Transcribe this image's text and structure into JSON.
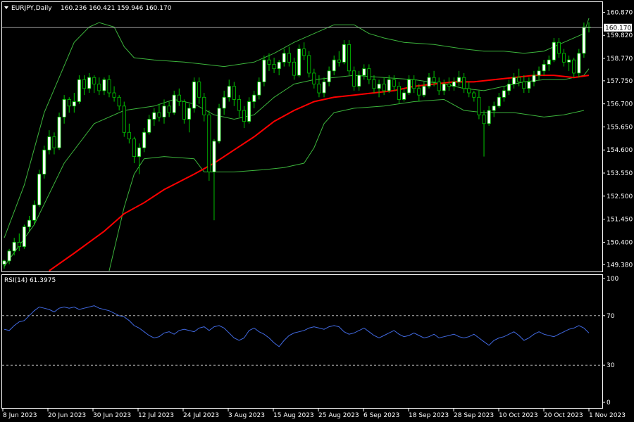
{
  "header": {
    "symbol": "EURJPY,Daily",
    "ohlc": "160.236 160.421 159.946 160.170"
  },
  "rsi_header": "RSI(14) 61.3975",
  "colors": {
    "background": "#000000",
    "grid_border": "#ffffff",
    "bull_candle": "#ffffff",
    "bear_candle": "#000000",
    "wick": "#00c800",
    "bollinger": "#3cb43c",
    "ma": "#ff0000",
    "rsi_line": "#4169e1",
    "level_line": "#b4b4b4"
  },
  "chart_data": [
    {
      "type": "candlestick",
      "ylim": [
        149.1,
        161.3
      ],
      "price_ticks": [
        "160.870",
        "159.820",
        "158.770",
        "157.750",
        "156.700",
        "155.650",
        "154.600",
        "153.550",
        "152.500",
        "151.450",
        "150.400",
        "149.380"
      ],
      "current_price": "160.170",
      "x_labels": [
        "8 Jun 2023",
        "20 Jun 2023",
        "30 Jun 2023",
        "12 Jul 2023",
        "24 Jul 2023",
        "3 Aug 2023",
        "15 Aug 2023",
        "25 Aug 2023",
        "6 Sep 2023",
        "18 Sep 2023",
        "28 Sep 2023",
        "10 Oct 2023",
        "20 Oct 2023",
        "1 Nov 2023"
      ],
      "candles": [
        [
          149.4,
          149.6,
          149.2,
          149.55
        ],
        [
          149.55,
          150.1,
          149.4,
          150.0
        ],
        [
          150.0,
          150.6,
          149.8,
          150.4
        ],
        [
          150.4,
          150.8,
          150.0,
          150.2
        ],
        [
          150.2,
          151.2,
          150.1,
          151.1
        ],
        [
          151.1,
          151.6,
          150.9,
          151.4
        ],
        [
          151.4,
          152.3,
          151.2,
          152.1
        ],
        [
          152.1,
          153.7,
          152.0,
          153.5
        ],
        [
          153.5,
          154.8,
          153.3,
          154.6
        ],
        [
          154.6,
          155.5,
          154.4,
          155.2
        ],
        [
          155.2,
          155.4,
          154.4,
          154.7
        ],
        [
          154.7,
          156.3,
          154.6,
          156.1
        ],
        [
          156.1,
          157.1,
          155.8,
          156.9
        ],
        [
          156.9,
          157.0,
          156.3,
          156.6
        ],
        [
          156.6,
          157.2,
          156.3,
          156.8
        ],
        [
          156.8,
          158.0,
          156.7,
          157.8
        ],
        [
          157.8,
          158.0,
          157.1,
          157.4
        ],
        [
          157.4,
          158.1,
          157.2,
          157.9
        ],
        [
          157.9,
          158.0,
          157.2,
          157.6
        ],
        [
          157.6,
          157.9,
          157.1,
          157.3
        ],
        [
          157.3,
          157.9,
          157.1,
          157.8
        ],
        [
          157.8,
          158.0,
          157.0,
          157.2
        ],
        [
          157.2,
          157.5,
          156.8,
          157.0
        ],
        [
          157.0,
          157.1,
          156.4,
          156.6
        ],
        [
          156.6,
          156.8,
          155.2,
          155.4
        ],
        [
          155.4,
          155.8,
          154.9,
          155.1
        ],
        [
          155.1,
          155.2,
          154.0,
          154.3
        ],
        [
          154.3,
          154.9,
          153.5,
          154.7
        ],
        [
          154.7,
          155.6,
          154.5,
          155.4
        ],
        [
          155.4,
          156.2,
          155.3,
          156.0
        ],
        [
          156.0,
          156.5,
          155.7,
          156.3
        ],
        [
          156.3,
          156.7,
          155.9,
          156.1
        ],
        [
          156.1,
          156.9,
          155.8,
          156.6
        ],
        [
          156.6,
          156.8,
          156.1,
          156.3
        ],
        [
          156.3,
          157.3,
          156.2,
          157.1
        ],
        [
          157.1,
          157.4,
          156.6,
          156.8
        ],
        [
          156.8,
          156.9,
          155.8,
          156.0
        ],
        [
          156.0,
          156.7,
          155.4,
          156.5
        ],
        [
          156.5,
          157.9,
          156.3,
          157.7
        ],
        [
          157.7,
          157.9,
          156.7,
          157.0
        ],
        [
          157.0,
          157.2,
          155.9,
          156.2
        ],
        [
          156.2,
          156.4,
          153.2,
          153.6
        ],
        [
          153.6,
          155.1,
          151.4,
          155.0
        ],
        [
          155.0,
          156.7,
          154.9,
          156.5
        ],
        [
          156.5,
          157.3,
          156.2,
          157.0
        ],
        [
          157.0,
          157.8,
          156.8,
          157.5
        ],
        [
          157.5,
          157.7,
          156.6,
          156.9
        ],
        [
          156.9,
          157.1,
          156.1,
          156.4
        ],
        [
          156.4,
          156.6,
          155.6,
          155.9
        ],
        [
          155.9,
          157.0,
          155.8,
          156.8
        ],
        [
          156.8,
          157.3,
          156.5,
          157.1
        ],
        [
          157.1,
          157.9,
          156.9,
          157.7
        ],
        [
          157.7,
          158.9,
          157.5,
          158.7
        ],
        [
          158.7,
          159.0,
          158.2,
          158.5
        ],
        [
          158.5,
          158.8,
          158.1,
          158.3
        ],
        [
          158.3,
          158.7,
          158.0,
          158.6
        ],
        [
          158.6,
          159.2,
          158.4,
          159.0
        ],
        [
          159.0,
          159.3,
          158.4,
          158.6
        ],
        [
          158.6,
          158.8,
          157.8,
          158.0
        ],
        [
          158.0,
          159.4,
          157.9,
          159.2
        ],
        [
          159.2,
          159.5,
          158.7,
          158.9
        ],
        [
          158.9,
          159.1,
          157.9,
          158.1
        ],
        [
          158.1,
          158.3,
          157.4,
          157.6
        ],
        [
          157.6,
          158.0,
          157.0,
          157.2
        ],
        [
          157.2,
          157.9,
          157.0,
          157.7
        ],
        [
          157.7,
          158.4,
          157.5,
          158.2
        ],
        [
          158.2,
          158.9,
          158.0,
          158.7
        ],
        [
          158.7,
          159.1,
          158.4,
          158.6
        ],
        [
          158.6,
          159.6,
          158.5,
          159.4
        ],
        [
          159.4,
          159.6,
          158.0,
          158.2
        ],
        [
          158.2,
          158.4,
          157.3,
          157.5
        ],
        [
          157.5,
          158.2,
          157.3,
          158.0
        ],
        [
          158.0,
          158.5,
          157.8,
          158.3
        ],
        [
          158.3,
          158.5,
          157.6,
          157.8
        ],
        [
          157.8,
          158.0,
          157.2,
          157.4
        ],
        [
          157.4,
          157.8,
          157.0,
          157.6
        ],
        [
          157.6,
          157.9,
          157.1,
          157.3
        ],
        [
          157.3,
          158.0,
          157.2,
          157.8
        ],
        [
          157.8,
          158.0,
          157.3,
          157.5
        ],
        [
          157.5,
          157.7,
          156.7,
          156.9
        ],
        [
          156.9,
          157.4,
          156.8,
          157.2
        ],
        [
          157.2,
          158.0,
          157.1,
          157.8
        ],
        [
          157.8,
          158.0,
          157.2,
          157.4
        ],
        [
          157.4,
          157.6,
          156.8,
          157.1
        ],
        [
          157.1,
          157.7,
          157.0,
          157.5
        ],
        [
          157.5,
          158.1,
          157.4,
          157.9
        ],
        [
          157.9,
          158.2,
          157.5,
          157.7
        ],
        [
          157.7,
          157.9,
          157.1,
          157.3
        ],
        [
          157.3,
          157.8,
          157.1,
          157.6
        ],
        [
          157.6,
          157.9,
          157.3,
          157.5
        ],
        [
          157.5,
          157.9,
          157.3,
          157.7
        ],
        [
          157.7,
          158.2,
          157.5,
          157.9
        ],
        [
          157.9,
          158.1,
          157.2,
          157.4
        ],
        [
          157.4,
          157.7,
          157.0,
          157.2
        ],
        [
          157.2,
          157.3,
          156.8,
          157.0
        ],
        [
          157.0,
          157.3,
          156.0,
          156.2
        ],
        [
          156.2,
          156.4,
          154.3,
          155.8
        ],
        [
          155.8,
          156.6,
          155.7,
          156.4
        ],
        [
          156.4,
          156.8,
          156.1,
          156.6
        ],
        [
          156.6,
          157.2,
          156.5,
          157.0
        ],
        [
          157.0,
          157.5,
          156.8,
          157.3
        ],
        [
          157.3,
          157.8,
          157.1,
          157.6
        ],
        [
          157.6,
          158.1,
          157.4,
          157.9
        ],
        [
          157.9,
          158.3,
          157.5,
          157.7
        ],
        [
          157.7,
          158.0,
          157.2,
          157.4
        ],
        [
          157.4,
          157.9,
          157.2,
          157.7
        ],
        [
          157.7,
          158.2,
          157.5,
          158.0
        ],
        [
          158.0,
          158.4,
          157.8,
          158.2
        ],
        [
          158.2,
          158.7,
          158.0,
          158.5
        ],
        [
          158.5,
          158.9,
          158.2,
          158.7
        ],
        [
          158.7,
          159.7,
          158.6,
          159.5
        ],
        [
          159.5,
          159.7,
          158.8,
          159.0
        ],
        [
          159.0,
          159.2,
          158.4,
          158.6
        ],
        [
          158.6,
          158.9,
          158.2,
          158.7
        ],
        [
          158.7,
          158.8,
          157.9,
          158.1
        ],
        [
          158.1,
          159.2,
          157.9,
          159.0
        ],
        [
          159.0,
          160.4,
          158.8,
          160.2
        ],
        [
          160.2,
          160.42,
          159.95,
          160.17
        ]
      ],
      "bollinger": {
        "upper": [
          [
            0,
            150.6
          ],
          [
            4,
            153.0
          ],
          [
            8,
            156.3
          ],
          [
            14,
            159.5
          ],
          [
            17,
            160.2
          ],
          [
            19,
            160.4
          ],
          [
            22,
            160.2
          ],
          [
            24,
            159.3
          ],
          [
            26,
            158.8
          ],
          [
            30,
            158.7
          ],
          [
            36,
            158.6
          ],
          [
            40,
            158.5
          ],
          [
            44,
            158.4
          ],
          [
            50,
            158.6
          ],
          [
            54,
            159.0
          ],
          [
            58,
            159.5
          ],
          [
            62,
            159.9
          ],
          [
            66,
            160.3
          ],
          [
            70,
            160.3
          ],
          [
            73,
            159.9
          ],
          [
            76,
            159.7
          ],
          [
            80,
            159.5
          ],
          [
            86,
            159.4
          ],
          [
            92,
            159.2
          ],
          [
            96,
            159.1
          ],
          [
            100,
            159.1
          ],
          [
            104,
            159.0
          ],
          [
            108,
            159.1
          ],
          [
            112,
            159.5
          ],
          [
            116,
            159.9
          ],
          [
            117,
            160.6
          ]
        ],
        "middle": [
          [
            0,
            149.3
          ],
          [
            6,
            151.2
          ],
          [
            12,
            154.0
          ],
          [
            18,
            155.8
          ],
          [
            24,
            156.4
          ],
          [
            30,
            156.6
          ],
          [
            34,
            156.9
          ],
          [
            38,
            156.7
          ],
          [
            42,
            156.2
          ],
          [
            46,
            156.0
          ],
          [
            50,
            156.2
          ],
          [
            54,
            157.0
          ],
          [
            58,
            157.6
          ],
          [
            62,
            157.8
          ],
          [
            66,
            157.9
          ],
          [
            70,
            158.0
          ],
          [
            76,
            157.9
          ],
          [
            82,
            157.8
          ],
          [
            88,
            157.6
          ],
          [
            92,
            157.4
          ],
          [
            96,
            157.3
          ],
          [
            100,
            157.5
          ],
          [
            104,
            157.7
          ],
          [
            108,
            157.8
          ],
          [
            112,
            157.8
          ],
          [
            116,
            158.0
          ],
          [
            117,
            158.3
          ]
        ],
        "lower": [
          [
            21,
            149.1
          ],
          [
            24,
            152.0
          ],
          [
            26,
            153.5
          ],
          [
            28,
            154.2
          ],
          [
            32,
            154.3
          ],
          [
            38,
            154.2
          ],
          [
            40,
            153.6
          ],
          [
            46,
            153.6
          ],
          [
            52,
            153.7
          ],
          [
            56,
            153.8
          ],
          [
            60,
            154.0
          ],
          [
            62,
            154.7
          ],
          [
            64,
            155.8
          ],
          [
            66,
            156.3
          ],
          [
            70,
            156.5
          ],
          [
            76,
            156.6
          ],
          [
            82,
            156.8
          ],
          [
            88,
            156.9
          ],
          [
            92,
            156.4
          ],
          [
            96,
            156.3
          ],
          [
            102,
            156.3
          ],
          [
            108,
            156.1
          ],
          [
            112,
            156.2
          ],
          [
            116,
            156.4
          ]
        ]
      },
      "moving_average": [
        [
          9,
          149.1
        ],
        [
          14,
          149.9
        ],
        [
          20,
          150.9
        ],
        [
          24,
          151.7
        ],
        [
          28,
          152.2
        ],
        [
          32,
          152.8
        ],
        [
          38,
          153.5
        ],
        [
          42,
          154.0
        ],
        [
          46,
          154.6
        ],
        [
          50,
          155.2
        ],
        [
          54,
          155.9
        ],
        [
          58,
          156.4
        ],
        [
          62,
          156.8
        ],
        [
          66,
          157.0
        ],
        [
          70,
          157.1
        ],
        [
          74,
          157.2
        ],
        [
          78,
          157.3
        ],
        [
          82,
          157.5
        ],
        [
          86,
          157.6
        ],
        [
          90,
          157.7
        ],
        [
          94,
          157.7
        ],
        [
          98,
          157.8
        ],
        [
          102,
          157.9
        ],
        [
          106,
          158.0
        ],
        [
          110,
          158.0
        ],
        [
          114,
          157.9
        ],
        [
          117,
          158.0
        ]
      ],
      "rsi": {
        "ylim": [
          0,
          100
        ],
        "ticks": [
          "100",
          "70",
          "30",
          "0"
        ],
        "levels": [
          70,
          30
        ],
        "values": [
          59,
          58,
          62,
          65,
          66,
          70,
          74,
          77,
          76,
          75,
          73,
          76,
          77,
          76,
          77,
          75,
          76,
          77,
          78,
          76,
          75,
          74,
          72,
          70,
          69,
          66,
          62,
          60,
          57,
          54,
          52,
          53,
          56,
          57,
          55,
          58,
          59,
          58,
          57,
          60,
          61,
          58,
          61,
          62,
          60,
          56,
          52,
          50,
          52,
          58,
          60,
          57,
          55,
          52,
          48,
          45,
          50,
          54,
          56,
          57,
          58,
          60,
          61,
          60,
          59,
          61,
          62,
          61,
          57,
          55,
          56,
          58,
          60,
          57,
          54,
          52,
          54,
          56,
          58,
          55,
          53,
          54,
          56,
          54,
          52,
          53,
          55,
          52,
          53,
          54,
          55,
          53,
          52,
          53,
          55,
          52,
          49,
          46,
          50,
          52,
          53,
          55,
          57,
          54,
          50,
          52,
          55,
          57,
          55,
          54,
          53,
          55,
          57,
          59,
          60,
          62,
          60,
          56
        ]
      }
    }
  ]
}
